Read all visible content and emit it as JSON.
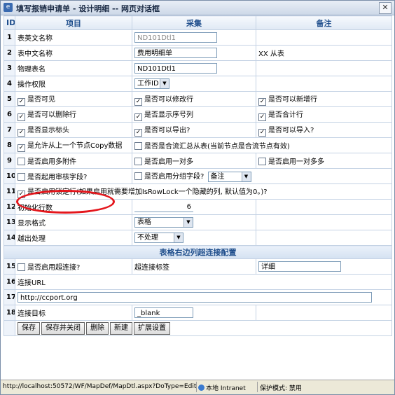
{
  "window": {
    "title": "填写报销申请单 - 设计明细 -- 网页对话框",
    "close_label": "✕"
  },
  "header": {
    "id": "ID",
    "item": "项目",
    "collect": "采集",
    "note": "备注"
  },
  "rows": {
    "r1": {
      "id": "1",
      "label": "表英文名称",
      "value": "ND101Dtl1"
    },
    "r2": {
      "id": "2",
      "label": "表中文名称",
      "value": "费用明细单",
      "note": "XX 从表"
    },
    "r3": {
      "id": "3",
      "label": "物理表名",
      "value": "ND101Dtl1"
    },
    "r4": {
      "id": "4",
      "label": "操作权限",
      "select": "工作ID"
    },
    "r5": {
      "id": "5",
      "c1": "是否可见",
      "c2": "是否可以修改行",
      "c3": "是否可以新增行"
    },
    "r6": {
      "id": "6",
      "c1": "是否可以删除行",
      "c2": "是否显示序号列",
      "c3": "是否合计行"
    },
    "r7": {
      "id": "7",
      "c1": "是否显示标头",
      "c2": "是否可以导出?",
      "c3": "是否可以导入?"
    },
    "r8": {
      "id": "8",
      "c1": "是允许从上一个节点Copy数据",
      "c2": "是否是合流汇总从表(当前节点是合流节点有效)"
    },
    "r9": {
      "id": "9",
      "c1": "是否启用多附件",
      "c2": "是否启用一对多",
      "c3": "是否启用一对多多"
    },
    "r10": {
      "id": "10",
      "c1": "是否起用审核字段?",
      "c2": "是否启用分组字段?",
      "select": "备注"
    },
    "r11": {
      "id": "11",
      "c1": "是否启用锁定行(如果启用就需要增加IsRowLock一个隐藏的列, 默认值为0。)?"
    },
    "r12": {
      "id": "12",
      "label": "初始化行数",
      "value": "6"
    },
    "r13": {
      "id": "13",
      "label": "显示格式",
      "select": "表格"
    },
    "r14": {
      "id": "14",
      "label": "越出处理",
      "select": "不处理"
    },
    "section": "表格右边列超连接配置",
    "r15": {
      "id": "15",
      "c1": "是否启用超连接?",
      "label2": "超连接标签",
      "value": "详细"
    },
    "r16": {
      "id": "16",
      "label": "连接URL"
    },
    "r17": {
      "id": "17",
      "value": "http://ccport.org"
    },
    "r18": {
      "id": "18",
      "label": "连接目标",
      "value": "_blank"
    }
  },
  "buttons": {
    "save": "保存",
    "save_close": "保存并关闭",
    "delete": "删除",
    "new": "新建",
    "ext": "扩展设置"
  },
  "status": {
    "url": "http://localhost:50572/WF/MapDef/MapDtl.aspx?DoType=Edit&",
    "zone": "本地 Intranet",
    "mode": "保护模式: 禁用"
  },
  "checks": {
    "r5c1": true,
    "r5c2": true,
    "r5c3": true,
    "r6c1": true,
    "r6c2": true,
    "r6c3": true,
    "r7c1": true,
    "r7c2": true,
    "r7c3": true,
    "r8c1": true,
    "r11c1": true
  },
  "colors": {
    "header_text": "#1f4e8c",
    "grid_border": "#c4d2e4",
    "highlight": "#e4161c"
  }
}
